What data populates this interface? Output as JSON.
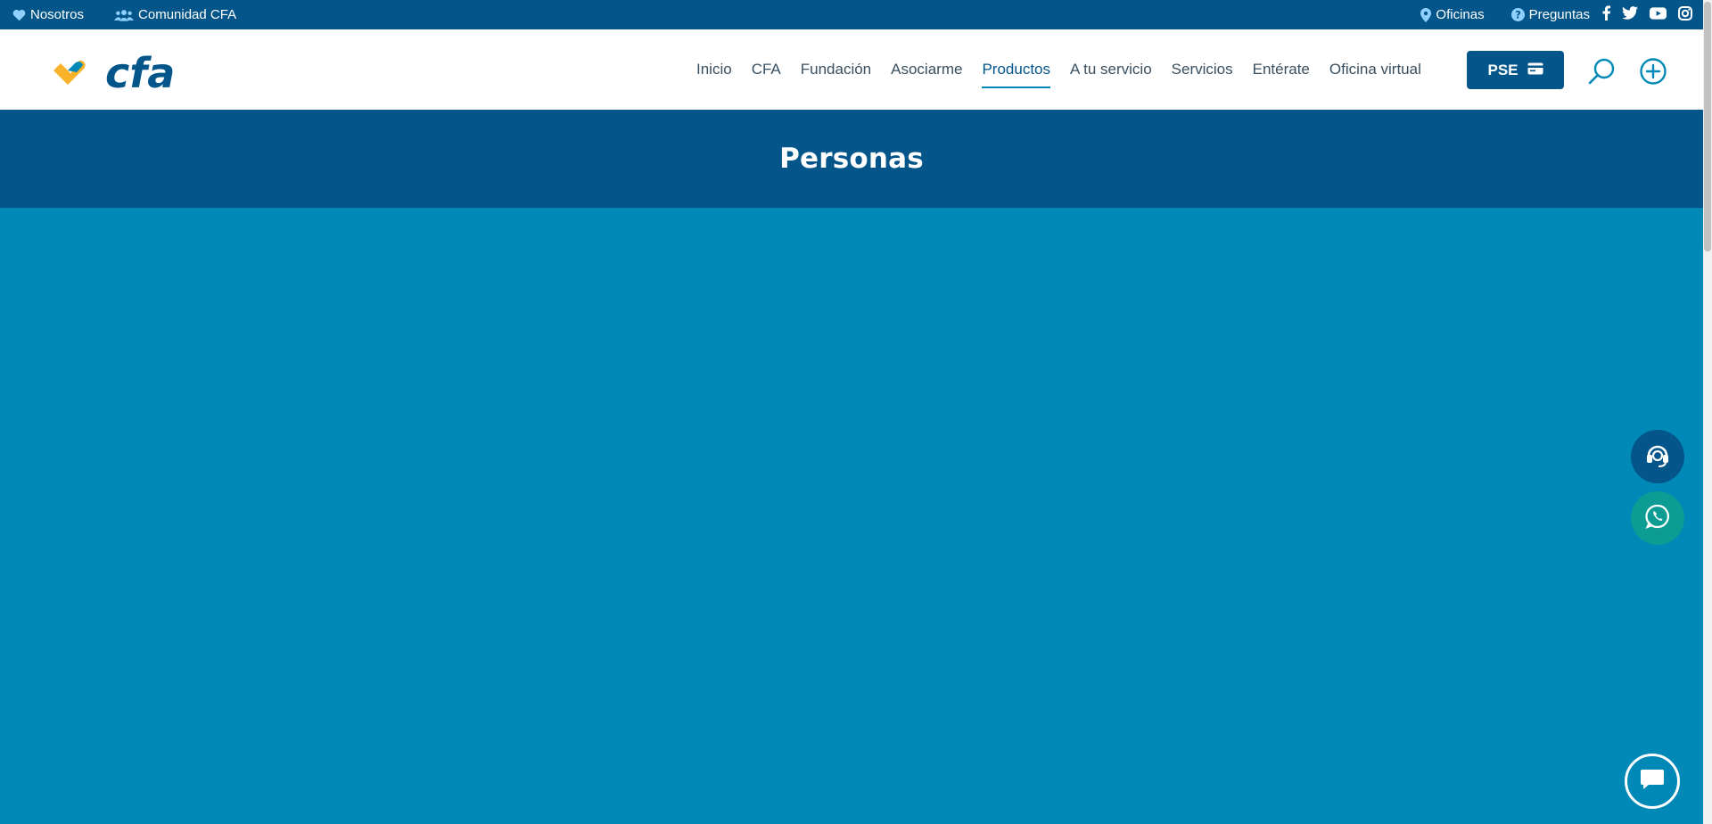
{
  "topbar": {
    "left_links": [
      {
        "label": "Nosotros",
        "icon": "heart-icon"
      },
      {
        "label": "Comunidad CFA",
        "icon": "users-icon"
      }
    ],
    "right_links": [
      {
        "label": "Oficinas",
        "icon": "map-pin-icon"
      },
      {
        "label": "Preguntas",
        "icon": "question-circle-icon"
      }
    ],
    "social": [
      "facebook-icon",
      "twitter-icon",
      "youtube-icon",
      "instagram-icon"
    ]
  },
  "header": {
    "logo_text": "cfa",
    "nav": [
      {
        "label": "Inicio"
      },
      {
        "label": "CFA"
      },
      {
        "label": "Fundación"
      },
      {
        "label": "Asociarme"
      },
      {
        "label": "Productos",
        "active": true
      },
      {
        "label": "A tu servicio"
      },
      {
        "label": "Servicios"
      },
      {
        "label": "Entérate"
      },
      {
        "label": "Oficina virtual"
      }
    ],
    "pse_label": "PSE"
  },
  "banner": {
    "title": "Personas"
  },
  "colors": {
    "brand_dark": "#03558a",
    "brand_light": "#0088b7",
    "accent_yellow": "#f9b32a",
    "whatsapp": "#0d9c93"
  }
}
